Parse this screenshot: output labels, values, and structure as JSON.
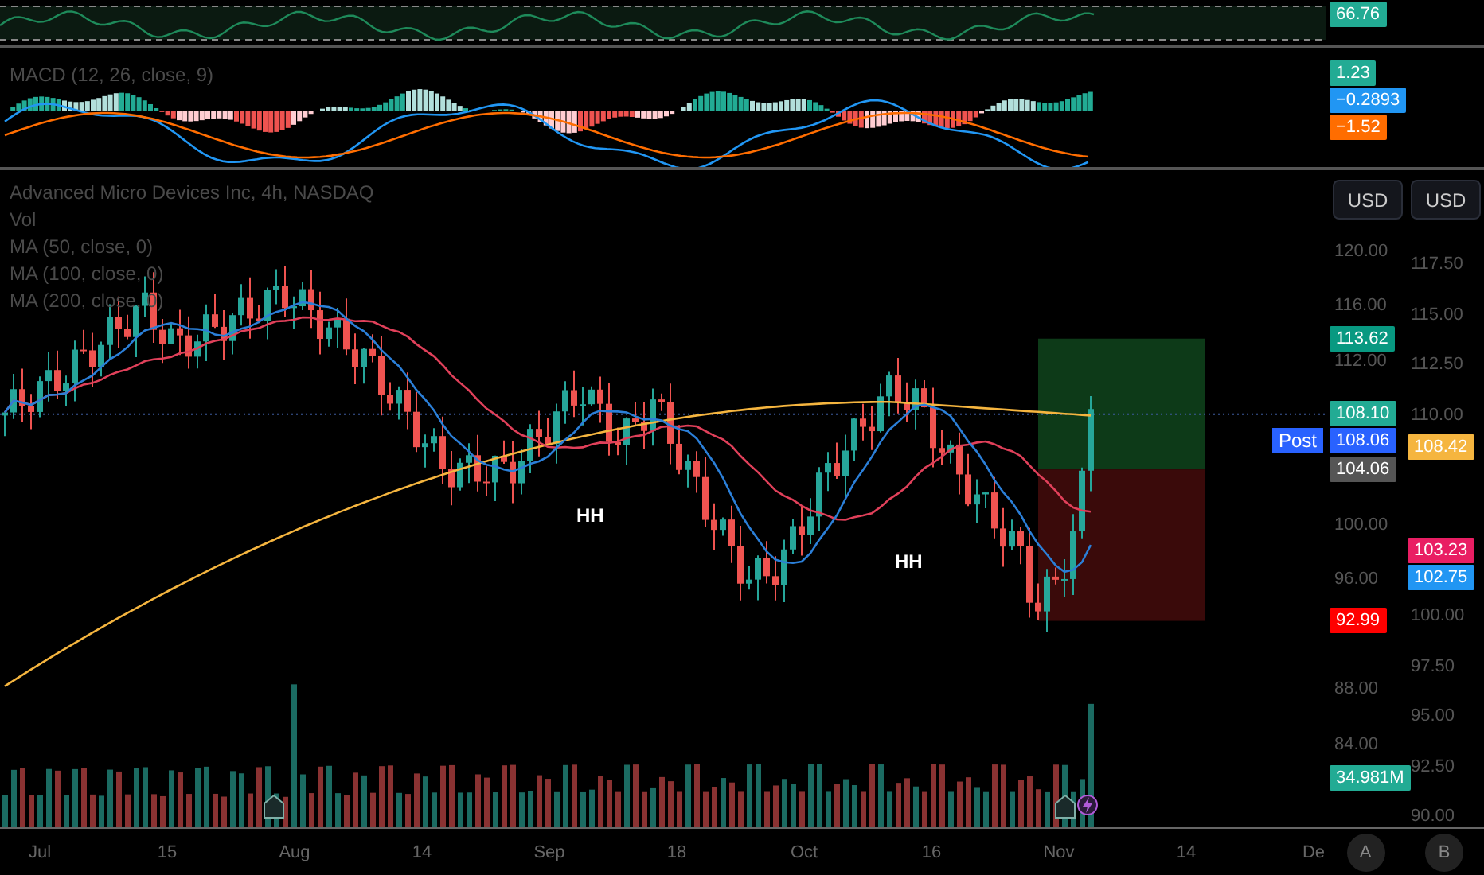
{
  "rsi_pane": {
    "value_badge": {
      "text": "66.76",
      "color": "#22ab94"
    }
  },
  "macd_pane": {
    "legend": "MACD (12, 26, close, 9)",
    "badges": [
      {
        "text": "1.23",
        "color": "#22ab94"
      },
      {
        "text": "−0.2893",
        "color": "#2196f3"
      },
      {
        "text": "−1.52",
        "color": "#ff6d00"
      }
    ]
  },
  "main_pane": {
    "legend": [
      "Advanced Micro Devices Inc, 4h, NASDAQ",
      "Vol",
      "MA (50, close, 0)",
      "MA (100, close, 0)",
      "MA (200, close, 0)"
    ],
    "currency_buttons": [
      "USD",
      "USD"
    ],
    "left_axis_ticks": [
      "120.00",
      "116.00",
      "112.00",
      "100.00",
      "96.00",
      "88.00",
      "84.00"
    ],
    "right_axis_ticks": [
      "117.50",
      "115.00",
      "112.50",
      "110.00",
      "100.00",
      "97.50",
      "95.00",
      "92.50",
      "90.00"
    ],
    "left_axis_badges": [
      {
        "text": "113.62",
        "color": "#089981"
      },
      {
        "text": "108.10",
        "color": "#22ab94"
      },
      {
        "text": "108.06",
        "color": "#2962ff"
      },
      {
        "text": "104.06",
        "color": "#555555"
      },
      {
        "text": "92.99",
        "color": "#ff0000"
      }
    ],
    "right_axis_badges": [
      {
        "text": "108.42",
        "color": "#f5b53f"
      },
      {
        "text": "103.23",
        "color": "#e91e63"
      },
      {
        "text": "102.75",
        "color": "#2196f3"
      }
    ],
    "post_label": "Post",
    "pattern_labels": [
      "HH",
      "HH"
    ],
    "volume_badge": {
      "text": "34.981M",
      "color": "#22ab94"
    }
  },
  "time_axis": {
    "labels": [
      "Jul",
      "15",
      "Aug",
      "14",
      "Sep",
      "18",
      "Oct",
      "16",
      "Nov",
      "14",
      "De"
    ],
    "buttons": [
      "A",
      "B"
    ]
  }
}
